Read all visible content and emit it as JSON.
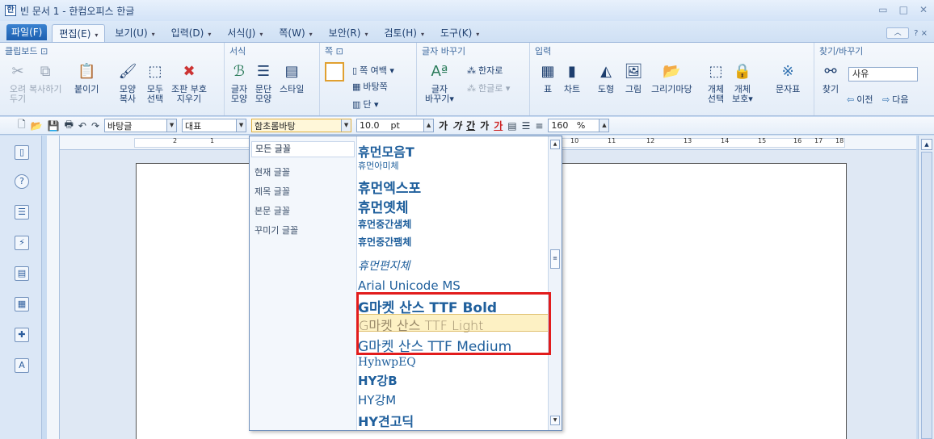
{
  "window": {
    "title": "빈 문서 1 - 한컴오피스 한글",
    "app_icon": "한",
    "controls": [
      "▭",
      "□",
      "✕"
    ]
  },
  "menu": {
    "file": "파일(F)",
    "tabs": [
      "편집(E)",
      "보기(U)",
      "입력(D)",
      "서식(J)",
      "쪽(W)",
      "보안(R)",
      "검토(H)",
      "도구(K)"
    ],
    "help": "? ×",
    "collapse": "︿"
  },
  "ribbon": {
    "groups": {
      "clipboard": "클립보드 ⊡",
      "format": "서식",
      "page": "쪽 ⊡",
      "text_replace": "글자 바꾸기",
      "insert": "입력",
      "find": "찾기/바꾸기"
    },
    "buttons": {
      "cut": "오려\n두기",
      "copy": "복사하기",
      "paste": "붙이기",
      "shape_copy": "모양\n복사",
      "select_all": "모두\n선택",
      "cut_draw": "조판 부호\n지우기",
      "char_shape": "글자\n모양",
      "para_shape": "문단\n모양",
      "style": "스타일",
      "page_margin": "쪽 여백 ▾",
      "bg_page": "바탕쪽",
      "column": "단 ▾",
      "char_replace": "글자\n바꾸기▾",
      "to_hanja": "한자로",
      "to_hangul": "한글로 ▾",
      "table": "표",
      "chart": "차트",
      "shape": "도형",
      "picture": "그림",
      "drawing": "그리기마당",
      "object_select": "개체\n선택",
      "object_protect": "개체\n보호▾",
      "char_map": "문자표",
      "find": "찾기",
      "prev": "이전",
      "next": "다음"
    },
    "find_input": "사유"
  },
  "toolbar": {
    "style_value": "바탕글",
    "lang_value": "대표",
    "font_value": "함초롬바탕",
    "size_value": "10.0",
    "size_unit": "pt",
    "bold": "가",
    "italic": "가",
    "underline": "간",
    "strike": "가",
    "color": "가",
    "zoom_value": "160",
    "zoom_unit": "%"
  },
  "ruler": {
    "numbers": [
      "2",
      "1",
      "10",
      "11",
      "12",
      "13",
      "14",
      "15",
      "16",
      "17",
      "18"
    ]
  },
  "font_dropdown": {
    "categories": [
      "모든 글꼴",
      "현재 글꼴",
      "제목 글꼴",
      "본문 글꼴",
      "꾸미기 글꼴"
    ],
    "fonts": [
      "휴먼모음T",
      "휴먼아미체",
      "휴먼엑스포",
      "휴먼옛체",
      "휴먼중간샘체",
      "휴먼중간팸체",
      "휴먼편지체",
      "Arial Unicode MS",
      "G마켓 산스 TTF Bold",
      "G마켓 산스 TTF Light",
      "G마켓 산스 TTF Medium",
      "HyhwpEQ",
      "HY강B",
      "HY강M",
      "HY견고딕"
    ]
  },
  "colors": {
    "accent": "#1c5fb0",
    "highlight_box": "#e21c1c",
    "hover_font": "#fdf1c4"
  }
}
